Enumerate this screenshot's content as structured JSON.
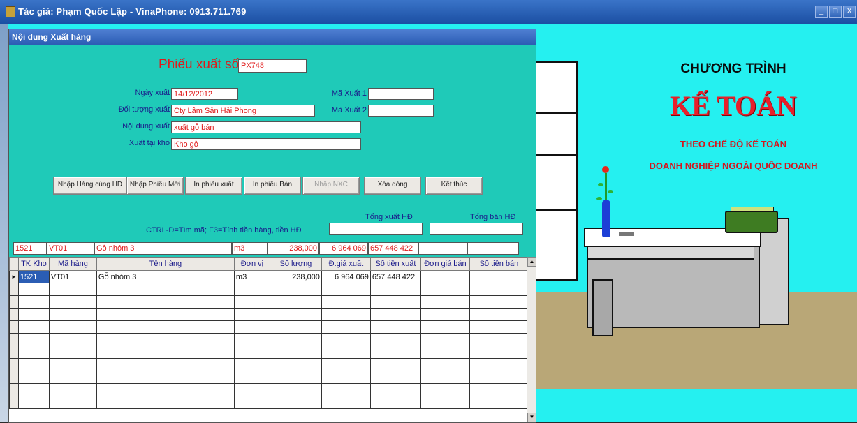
{
  "app": {
    "title": "Tác giả: Phạm Quốc Lập - VinaPhone: 0913.711.769",
    "minimize": "_",
    "restore": "□",
    "close": "X"
  },
  "art": {
    "line1": "CHƯƠNG TRÌNH",
    "line2": "KẾ TOÁN",
    "line3": "THEO CHẾ ĐỘ KẾ TOÁN",
    "line4": "DOANH NGHIỆP NGOÀI QUỐC DOANH"
  },
  "form": {
    "window_title": "Nội dung Xuất hàng",
    "heading": "Phiếu xuất số",
    "voucher_no": "PX748",
    "fields": {
      "date_label": "Ngày xuất",
      "date_value": "14/12/2012",
      "partner_label": "Đối tượng xuất",
      "partner_value": "Cty Lâm Sản Hải Phong",
      "content_label": "Nội dung xuất",
      "content_value": "xuất gỗ bán",
      "warehouse_label": "Xuất tại kho",
      "warehouse_value": "Kho gỗ",
      "code1_label": "Mã Xuất 1",
      "code1_value": "",
      "code2_label": "Mã Xuất 2",
      "code2_value": ""
    },
    "buttons": [
      {
        "label": "Nhập Hàng cùng HĐ"
      },
      {
        "label": "Nhập Phiếu Mới"
      },
      {
        "label": "In phiếu xuất"
      },
      {
        "label": "In phiếu Bán"
      },
      {
        "label": "Nhập NXC"
      },
      {
        "label": "Xóa dòng"
      },
      {
        "label": "Kết thúc"
      }
    ],
    "hint": "CTRL-D=Tìm mã; F3=Tính tiền hàng, tiền HĐ",
    "total_export_label": "Tổng xuất HĐ",
    "total_export_value": "",
    "total_sale_label": "Tổng bán HĐ",
    "total_sale_value": ""
  },
  "edit_row": {
    "account": "1521",
    "code": "VT01",
    "name": "Gỗ nhóm 3",
    "unit": "m3",
    "qty": "238,000",
    "price": "6 964 069",
    "amount": "657 448 422",
    "sale_price": "",
    "sale_amount": ""
  },
  "grid": {
    "columns": [
      "TK Kho",
      "Mã hàng",
      "Tên hàng",
      "Đơn vị",
      "Số lượng",
      "Đ.giá xuất",
      "Số tiền xuất",
      "Đơn giá bán",
      "Số tiền bán"
    ],
    "rows": [
      [
        "1521",
        "VT01",
        "Gỗ nhóm 3",
        "m3",
        "238,000",
        "6 964 069",
        "657 448 422",
        "",
        ""
      ]
    ]
  }
}
